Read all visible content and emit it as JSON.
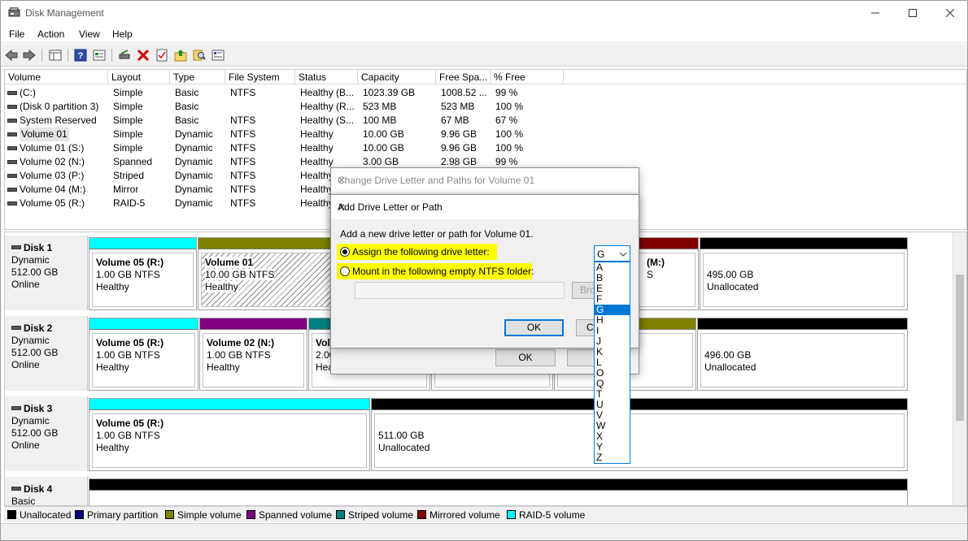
{
  "window": {
    "title": "Disk Management"
  },
  "menu": [
    "File",
    "Action",
    "View",
    "Help"
  ],
  "columns": [
    "Volume",
    "Layout",
    "Type",
    "File System",
    "Status",
    "Capacity",
    "Free Spa...",
    "% Free"
  ],
  "volumes": [
    {
      "name": "(C:)",
      "layout": "Simple",
      "type": "Basic",
      "fs": "NTFS",
      "status": "Healthy (B...",
      "capacity": "1023.39 GB",
      "free": "1008.52 ...",
      "pct": "99 %"
    },
    {
      "name": "(Disk 0 partition 3)",
      "layout": "Simple",
      "type": "Basic",
      "fs": "",
      "status": "Healthy (R...",
      "capacity": "523 MB",
      "free": "523 MB",
      "pct": "100 %"
    },
    {
      "name": "System Reserved",
      "layout": "Simple",
      "type": "Basic",
      "fs": "NTFS",
      "status": "Healthy (S...",
      "capacity": "100 MB",
      "free": "67 MB",
      "pct": "67 %"
    },
    {
      "name": "Volume 01",
      "layout": "Simple",
      "type": "Dynamic",
      "fs": "NTFS",
      "status": "Healthy",
      "capacity": "10.00 GB",
      "free": "9.96 GB",
      "pct": "100 %"
    },
    {
      "name": "Volume 01 (S:)",
      "layout": "Simple",
      "type": "Dynamic",
      "fs": "NTFS",
      "status": "Healthy",
      "capacity": "10.00 GB",
      "free": "9.96 GB",
      "pct": "100 %"
    },
    {
      "name": "Volume 02 (N:)",
      "layout": "Spanned",
      "type": "Dynamic",
      "fs": "NTFS",
      "status": "Healthy",
      "capacity": "3.00 GB",
      "free": "2.98 GB",
      "pct": "99 %"
    },
    {
      "name": "Volume 03 (P:)",
      "layout": "Striped",
      "type": "Dynamic",
      "fs": "NTFS",
      "status": "Healthy",
      "capacity": "",
      "free": "",
      "pct": ""
    },
    {
      "name": "Volume 04 (M:)",
      "layout": "Mirror",
      "type": "Dynamic",
      "fs": "NTFS",
      "status": "Healthy",
      "capacity": "",
      "free": "",
      "pct": ""
    },
    {
      "name": "Volume 05 (R:)",
      "layout": "RAID-5",
      "type": "Dynamic",
      "fs": "NTFS",
      "status": "Healthy",
      "capacity": "",
      "free": "",
      "pct": ""
    }
  ],
  "disks": [
    {
      "name": "Disk 1",
      "type": "Dynamic",
      "size": "512.00 GB",
      "state": "Online"
    },
    {
      "name": "Disk 2",
      "type": "Dynamic",
      "size": "512.00 GB",
      "state": "Online"
    },
    {
      "name": "Disk 3",
      "type": "Dynamic",
      "size": "512.00 GB",
      "state": "Online"
    },
    {
      "name": "Disk 4",
      "type": "Basic"
    }
  ],
  "partitions": {
    "d1p1": {
      "name": "Volume 05  (R:)",
      "size": "1.00 GB NTFS",
      "status": "Healthy"
    },
    "d1p2": {
      "name": "Volume 01",
      "size": "10.00 GB NTFS",
      "status": "Healthy"
    },
    "d1p3": {
      "name": "(M:)",
      "size": "S"
    },
    "d1p4": {
      "size": "495.00 GB",
      "status": "Unallocated"
    },
    "d2p1": {
      "name": "Volume 05  (R:)",
      "size": "1.00 GB NTFS",
      "status": "Healthy"
    },
    "d2p2": {
      "name": "Volume 02  (N:)",
      "size": "1.00 GB NTFS",
      "status": "Healthy"
    },
    "d2p3": {
      "name": "Volu",
      "size": "2.00",
      "status": "Hea"
    },
    "d2p4": {
      "size": "496.00 GB",
      "status": "Unallocated"
    },
    "d3p1": {
      "name": "Volume 05  (R:)",
      "size": "1.00 GB NTFS",
      "status": "Healthy"
    },
    "d3p2": {
      "size": "511.00 GB",
      "status": "Unallocated"
    }
  },
  "legend": [
    {
      "label": "Unallocated",
      "color": "#000000"
    },
    {
      "label": "Primary partition",
      "color": "#000080"
    },
    {
      "label": "Simple volume",
      "color": "#808000"
    },
    {
      "label": "Spanned volume",
      "color": "#800080"
    },
    {
      "label": "Striped volume",
      "color": "#008080"
    },
    {
      "label": "Mirrored volume",
      "color": "#800000"
    },
    {
      "label": "RAID-5 volume",
      "color": "#00ffff"
    }
  ],
  "dialog_back": {
    "title": "Change Drive Letter and Paths for Volume 01",
    "ok": "OK",
    "cancel": "Ca"
  },
  "dialog_front": {
    "title": "Add Drive Letter or Path",
    "intro": "Add a new drive letter or path for Volume 01.",
    "opt_assign": "Assign the following drive letter:",
    "opt_mount": "Mount in the following empty NTFS folder:",
    "browse": "Bro",
    "ok": "OK",
    "cancel": "Ca",
    "selected_letter": "G",
    "letters": [
      "A",
      "B",
      "E",
      "F",
      "G",
      "H",
      "I",
      "J",
      "K",
      "L",
      "O",
      "Q",
      "T",
      "U",
      "V",
      "W",
      "X",
      "Y",
      "Z"
    ]
  }
}
